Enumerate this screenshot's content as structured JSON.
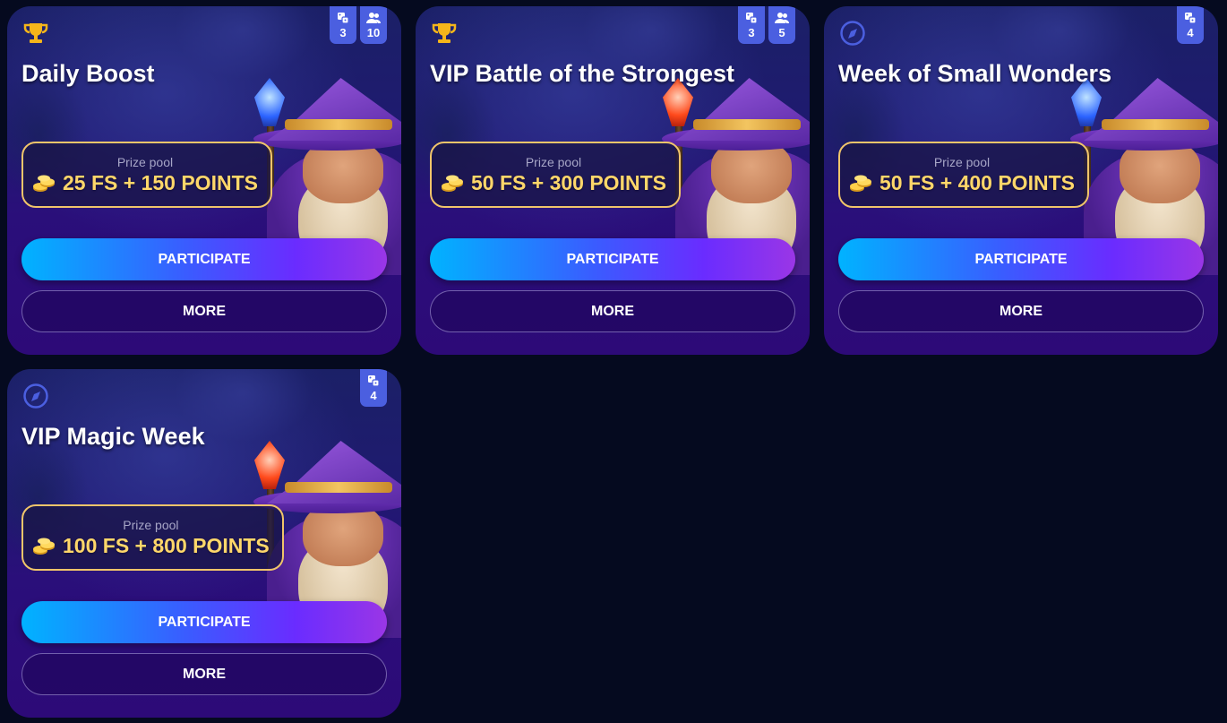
{
  "colors": {
    "page_background": "#050a1f",
    "counter_badge": "#4b5fe0",
    "prize_text": "#ffd76a",
    "prize_border": "#f0c56a",
    "trophy": "#f5b51a",
    "compass": "#4b5fe0"
  },
  "cards": [
    {
      "type_icon": "trophy-icon",
      "title": "Daily Boost",
      "games_count": "3",
      "players_count": "10",
      "prize_label": "Prize pool",
      "prize_value": "25 FS + 150 POINTS",
      "gem": "blue",
      "participate_label": "PARTICIPATE",
      "more_label": "MORE"
    },
    {
      "type_icon": "trophy-icon",
      "title": "VIP Battle of the Strongest",
      "games_count": "3",
      "players_count": "5",
      "prize_label": "Prize pool",
      "prize_value": "50 FS + 300 POINTS",
      "gem": "red",
      "participate_label": "PARTICIPATE",
      "more_label": "MORE"
    },
    {
      "type_icon": "compass-icon",
      "title": "Week of Small Wonders",
      "games_count": "4",
      "prize_label": "Prize pool",
      "prize_value": "50 FS + 400 POINTS",
      "gem": "blue",
      "participate_label": "PARTICIPATE",
      "more_label": "MORE"
    },
    {
      "type_icon": "compass-icon",
      "title": "VIP Magic Week",
      "games_count": "4",
      "prize_label": "Prize pool",
      "prize_value": "100 FS + 800 POINTS",
      "gem": "red",
      "participate_label": "PARTICIPATE",
      "more_label": "MORE"
    }
  ]
}
